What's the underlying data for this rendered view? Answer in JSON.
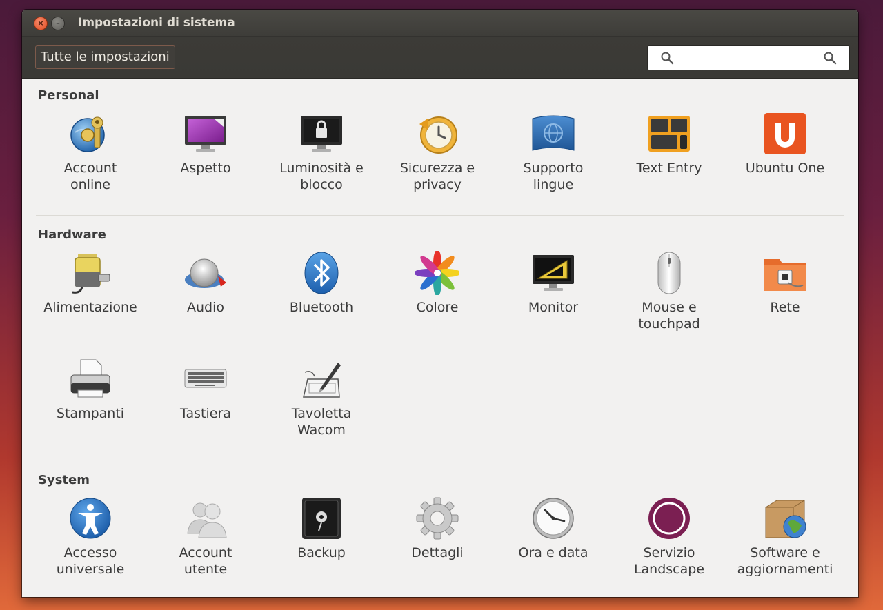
{
  "window": {
    "title": "Impostazioni di sistema"
  },
  "toolbar": {
    "all_settings_label": "Tutte le impostazioni",
    "search_value": ""
  },
  "sections": {
    "personal": {
      "title": "Personal",
      "items": [
        {
          "label_1": "Account",
          "label_2": "online",
          "icon": "online-accounts-icon"
        },
        {
          "label_1": "Aspetto",
          "label_2": "",
          "icon": "appearance-icon"
        },
        {
          "label_1": "Luminosità e",
          "label_2": "blocco",
          "icon": "brightness-lock-icon"
        },
        {
          "label_1": "Sicurezza e",
          "label_2": "privacy",
          "icon": "security-privacy-icon"
        },
        {
          "label_1": "Supporto",
          "label_2": "lingue",
          "icon": "language-support-icon"
        },
        {
          "label_1": "Text Entry",
          "label_2": "",
          "icon": "text-entry-icon"
        },
        {
          "label_1": "Ubuntu One",
          "label_2": "",
          "icon": "ubuntu-one-icon"
        }
      ]
    },
    "hardware": {
      "title": "Hardware",
      "items": [
        {
          "label_1": "Alimentazione",
          "label_2": "",
          "icon": "power-icon"
        },
        {
          "label_1": "Audio",
          "label_2": "",
          "icon": "sound-icon"
        },
        {
          "label_1": "Bluetooth",
          "label_2": "",
          "icon": "bluetooth-icon"
        },
        {
          "label_1": "Colore",
          "label_2": "",
          "icon": "color-icon"
        },
        {
          "label_1": "Monitor",
          "label_2": "",
          "icon": "display-icon"
        },
        {
          "label_1": "Mouse e",
          "label_2": "touchpad",
          "icon": "mouse-icon"
        },
        {
          "label_1": "Rete",
          "label_2": "",
          "icon": "network-icon"
        },
        {
          "label_1": "Stampanti",
          "label_2": "",
          "icon": "printer-icon"
        },
        {
          "label_1": "Tastiera",
          "label_2": "",
          "icon": "keyboard-icon"
        },
        {
          "label_1": "Tavoletta",
          "label_2": "Wacom",
          "icon": "wacom-tablet-icon"
        }
      ]
    },
    "system": {
      "title": "System",
      "items": [
        {
          "label_1": "Accesso",
          "label_2": "universale",
          "icon": "universal-access-icon"
        },
        {
          "label_1": "Account",
          "label_2": "utente",
          "icon": "user-accounts-icon"
        },
        {
          "label_1": "Backup",
          "label_2": "",
          "icon": "backup-icon"
        },
        {
          "label_1": "Dettagli",
          "label_2": "",
          "icon": "details-icon"
        },
        {
          "label_1": "Ora e data",
          "label_2": "",
          "icon": "time-date-icon"
        },
        {
          "label_1": "Servizio",
          "label_2": "Landscape",
          "icon": "landscape-icon"
        },
        {
          "label_1": "Software e",
          "label_2": "aggiornamenti",
          "icon": "software-updates-icon"
        }
      ]
    }
  }
}
